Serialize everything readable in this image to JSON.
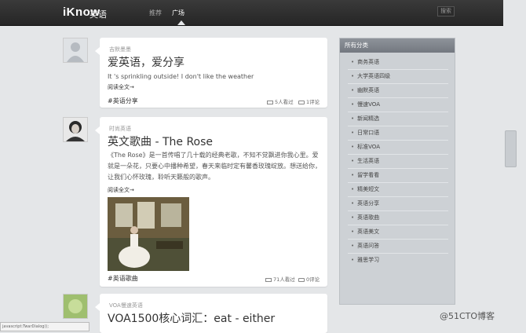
{
  "header": {
    "logo": "iKnow",
    "logo_sub": "英语",
    "nav": [
      "推荐",
      "广场"
    ],
    "search_label": "搜索"
  },
  "feed": [
    {
      "category": "吉默墨墨",
      "title": "爱英语，爱分享",
      "excerpt": "It 's sprinkling outside! I don't like the weather",
      "readmore": "阅读全文→",
      "tag": "#英语分享",
      "views": "5人看过",
      "comments": "1评论"
    },
    {
      "category": "时尚英语",
      "title": "英文歌曲 - The Rose",
      "excerpt": "《The Rose》是一首传唱了几十载的经典老歌，不知不觉飘进你我心里。爱就是一朵花，只要心中播种希望，春天来临时定有馨香玫瑰绽放。想送给你，让我们心怀玫瑰，聆听天籁般的歌声。",
      "readmore": "阅读全文→",
      "tag": "#英语歌曲",
      "views": "71人看过",
      "comments": "0评论"
    },
    {
      "category": "VOA慢速英语",
      "title": "VOA1500核心词汇：eat - either"
    }
  ],
  "sidebar": {
    "title": "所有分类",
    "items": [
      "商务英语",
      "大学英语四级",
      "幽默英语",
      "慢速VOA",
      "新闻精选",
      "日常口语",
      "标准VOA",
      "生活英语",
      "留学看看",
      "精美短文",
      "英语分享",
      "英语歌曲",
      "英语美文",
      "英语问答",
      "雅思学习"
    ]
  },
  "status_text": "javascript:TwarDialog();",
  "watermark": "@51CTO博客"
}
